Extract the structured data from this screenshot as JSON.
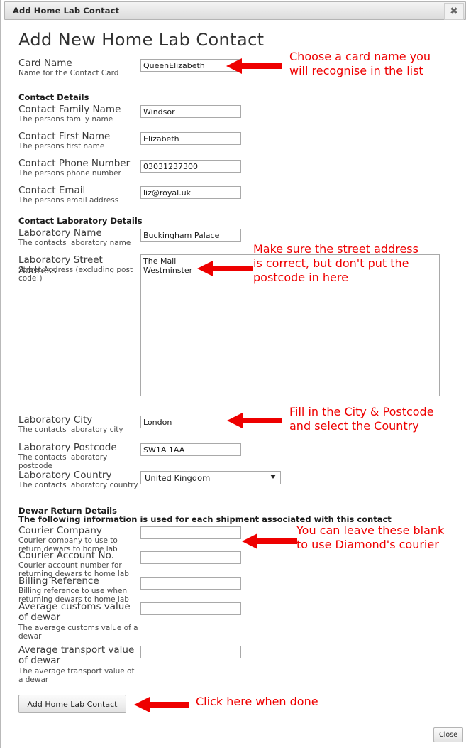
{
  "window": {
    "title": "Add Home Lab Contact",
    "close_icon": "close-icon",
    "close_glyph": "✖"
  },
  "page": {
    "title": "Add New Home Lab Contact"
  },
  "colors": {
    "annotation_red": "#ee0000",
    "text": "#3a3a3a",
    "field_border": "#a9a9a9"
  },
  "sections": {
    "contact_details": "Contact Details",
    "contact_laboratory_details": "Contact Laboratory Details",
    "dewar_return_details": "Dewar Return Details",
    "dewar_return_subtitle": "The following information is used for each shipment associated with this contact"
  },
  "fields": {
    "card_name": {
      "label": "Card Name",
      "help": "Name for the Contact Card",
      "value": "QueenElizabeth",
      "placeholder": ""
    },
    "contact_family_name": {
      "label": "Contact Family Name",
      "help": "The persons family name",
      "value": "Windsor",
      "placeholder": ""
    },
    "contact_first_name": {
      "label": "Contact First Name",
      "help": "The persons first name",
      "value": "Elizabeth",
      "placeholder": ""
    },
    "contact_phone_number": {
      "label": "Contact Phone Number",
      "help": "The persons phone number",
      "value": "03031237300",
      "placeholder": ""
    },
    "contact_email": {
      "label": "Contact Email",
      "help": "The persons email address",
      "value": "liz@royal.uk",
      "placeholder": ""
    },
    "laboratory_name": {
      "label": "Laboratory Name",
      "help": "The contacts laboratory name",
      "value": "Buckingham Palace",
      "placeholder": ""
    },
    "laboratory_street_address": {
      "label": "Laboratory Street Address",
      "help": "Street Address (excluding post code!)",
      "value": "The Mall\nWestminster",
      "placeholder": ""
    },
    "laboratory_city": {
      "label": "Laboratory City",
      "help": "The contacts laboratory city",
      "value": "London",
      "placeholder": ""
    },
    "laboratory_postcode": {
      "label": "Laboratory Postcode",
      "help": "The contacts laboratory postcode",
      "value": "SW1A 1AA",
      "placeholder": ""
    },
    "laboratory_country": {
      "label": "Laboratory Country",
      "help": "The contacts laboratory country",
      "value": "United Kingdom",
      "options": [
        "United Kingdom"
      ]
    },
    "courier_company": {
      "label": "Courier Company",
      "help": "Courier company to use to return dewars to home lab",
      "value": "",
      "placeholder": ""
    },
    "courier_account_no": {
      "label": "Courier Account No.",
      "help": "Courier account number for returning dewars to home lab",
      "value": "",
      "placeholder": ""
    },
    "billing_reference": {
      "label": "Billing Reference",
      "help": "Billing reference to use when returning dewars to home lab",
      "value": "",
      "placeholder": ""
    },
    "average_customs_value": {
      "label": "Average customs value of dewar",
      "help": "The average customs value of a dewar",
      "value": "",
      "placeholder": ""
    },
    "average_transport_value": {
      "label": "Average transport value of dewar",
      "help": "The average transport value of a dewar",
      "value": "",
      "placeholder": ""
    }
  },
  "annotations": {
    "card_name": "Choose a card name you\nwill recognise in the list",
    "street_address": "Make sure the street address\nis correct, but don't put the\npostcode in here",
    "city_postcode": "Fill in the City & Postcode\nand select the Country",
    "dewar": "You can leave these blank\nto use Diamond's courier",
    "submit": "Click here when done"
  },
  "buttons": {
    "submit": "Add Home Lab Contact",
    "close": "Close"
  }
}
